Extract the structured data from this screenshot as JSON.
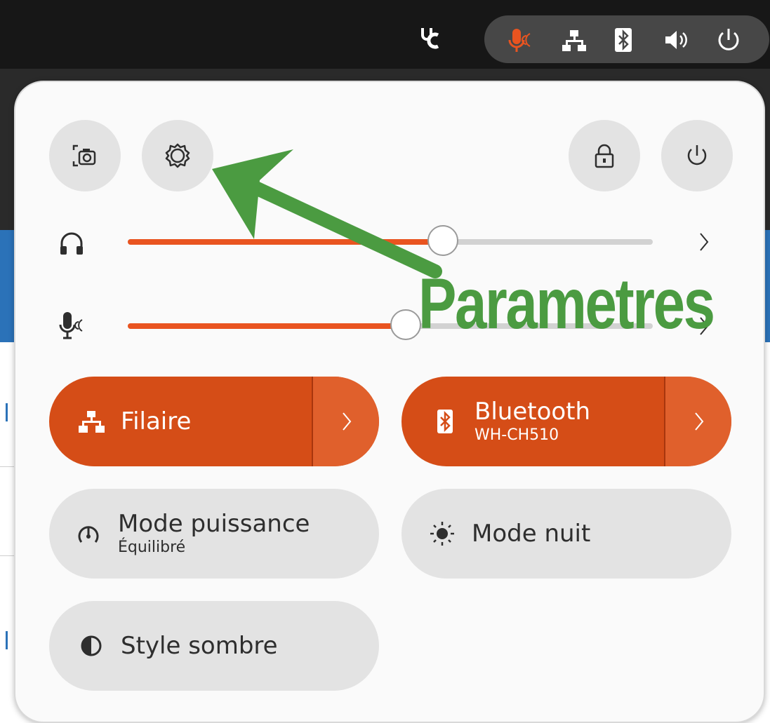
{
  "top_bar": {
    "tray_icons": [
      "accessibility-icon",
      "microphone-icon",
      "wired-network-icon",
      "bluetooth-icon",
      "volume-icon",
      "power-icon"
    ],
    "mic_active_color": "#e95420"
  },
  "panel": {
    "header_buttons": [
      "screenshot-icon",
      "settings-icon",
      "lock-icon",
      "power-icon"
    ],
    "sliders": [
      {
        "icon": "headphones-icon",
        "level": 0.6
      },
      {
        "icon": "microphone-icon",
        "level": 0.53
      }
    ],
    "tiles": {
      "wired": {
        "title": "Filaire",
        "active": true
      },
      "bluetooth": {
        "title": "Bluetooth",
        "subtitle": "WH-CH510",
        "active": true
      },
      "power_mode": {
        "title": "Mode puissance",
        "subtitle": "Équilibré",
        "active": false
      },
      "night_mode": {
        "title": "Mode nuit",
        "active": false
      },
      "dark_style": {
        "title": "Style sombre",
        "active": false
      }
    },
    "accent_color": "#e95420",
    "tile_active_color": "#d54d17"
  },
  "annotation": {
    "label": "Parametres",
    "color": "#4b9b41"
  }
}
